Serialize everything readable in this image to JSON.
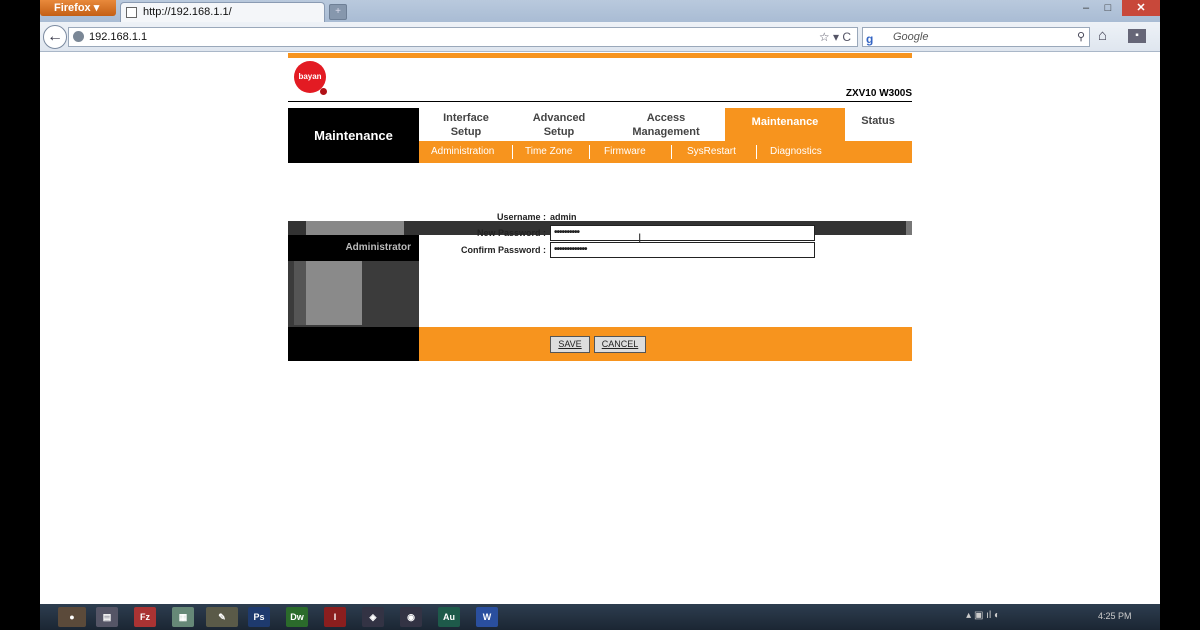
{
  "browser": {
    "menu_label": "Firefox",
    "tab_title": "http://192.168.1.1/",
    "url": "192.168.1.1",
    "search_placeholder": "Google",
    "search_engine_glyph": "g",
    "icons": [
      "back-icon",
      "globe-icon",
      "star-icon",
      "reload-icon",
      "search-icon",
      "home-icon",
      "addon-icon"
    ]
  },
  "router": {
    "model": "ZXV10 W300S",
    "section_title": "Maintenance",
    "nav": [
      {
        "line1": "Interface",
        "line2": "Setup"
      },
      {
        "line1": "Advanced",
        "line2": "Setup"
      },
      {
        "line1": "Access",
        "line2": "Management"
      },
      {
        "line1": "Maintenance",
        "line2": ""
      },
      {
        "line1": "Status",
        "line2": ""
      }
    ],
    "subnav": [
      "Administration",
      "Time Zone",
      "Firmware",
      "SysRestart",
      "Diagnostics"
    ],
    "side_title": "Administrator",
    "form": {
      "username_label": "Username :",
      "username_value": "admin",
      "new_password_label": "New Password :",
      "new_password_value": "••••••••••",
      "confirm_password_label": "Confirm Password :",
      "confirm_password_value": "•••••••••••••"
    },
    "buttons": {
      "save": "SAVE",
      "cancel": "CANCEL"
    }
  },
  "taskbar": {
    "apps": [
      "firefox",
      "explorer",
      "filezilla",
      "notepad",
      "gimp",
      "photoshop",
      "dreamweaver",
      "illustrator",
      "app",
      "app",
      "audition",
      "word"
    ],
    "clock": "4:25 PM"
  },
  "colors": {
    "accent": "#f7941e",
    "dark": "#000000"
  }
}
